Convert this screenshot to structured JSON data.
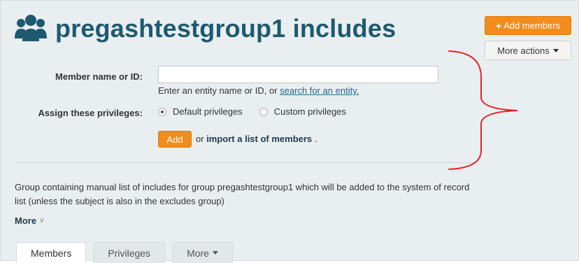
{
  "header": {
    "title": "pregashtestgroup1 includes",
    "icon": "group-icon"
  },
  "actions": {
    "add_members_label": "Add members",
    "more_actions_label": "More actions"
  },
  "form": {
    "member_label": "Member name or ID:",
    "member_value": "",
    "hint_prefix": "Enter an entity name or ID, or",
    "hint_link": "search for an entity.",
    "privileges_label": "Assign these privileges:",
    "privilege_options": [
      {
        "label": "Default privileges",
        "selected": true
      },
      {
        "label": "Custom privileges",
        "selected": false
      }
    ],
    "add_button": "Add",
    "or_text": "or",
    "import_link": "import a list of members",
    "import_suffix": "."
  },
  "description": "Group containing manual list of includes for group pregashtestgroup1 which will be added to the system of record list (unless the subject is also in the excludes group)",
  "more_label": "More",
  "tabs": [
    {
      "label": "Members",
      "active": true
    },
    {
      "label": "Privileges",
      "active": false
    },
    {
      "label": "More",
      "active": false
    }
  ],
  "colors": {
    "accent_orange": "#f28c1c",
    "title_teal": "#1d5a70",
    "annotation_red": "#e8232a"
  }
}
